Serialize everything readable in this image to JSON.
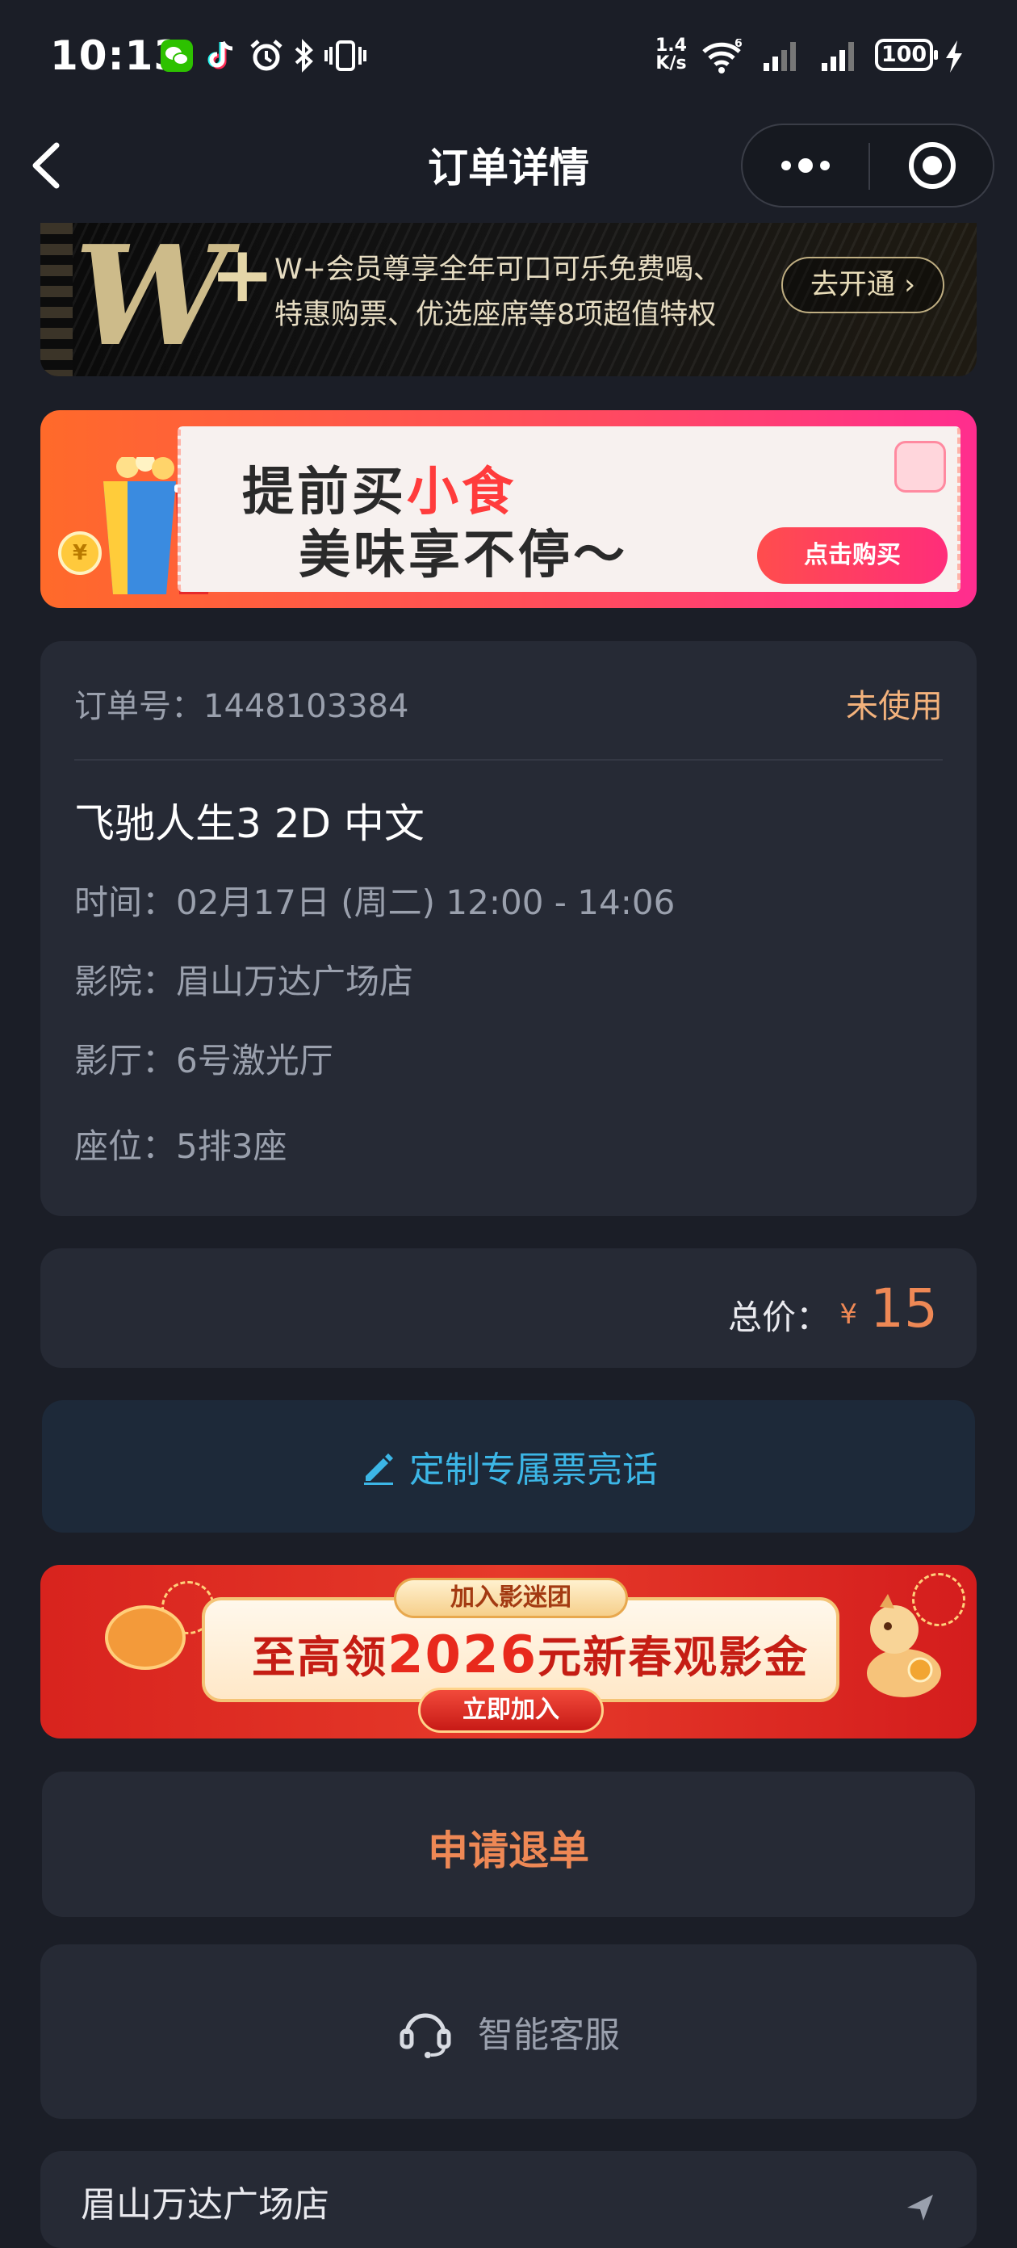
{
  "status_bar": {
    "time": "10:13",
    "net_speed_value": "1.4",
    "net_speed_unit": "K/s",
    "signal_label": "6",
    "battery": "100",
    "icons": [
      "wechat-icon",
      "tiktok-icon",
      "alarm-icon",
      "bluetooth-icon",
      "vibrate-icon",
      "wifi-icon",
      "signal-icon",
      "charging-icon"
    ]
  },
  "nav": {
    "title": "订单详情",
    "back_icon": "chevron-left-icon",
    "more_icon": "more-dots-icon",
    "close_icon": "target-close-icon"
  },
  "vip_banner": {
    "logo": "W",
    "plus": "+",
    "line1": "W+会员尊享全年可口可乐免费喝、",
    "line2": "特惠购票、优选座席等8项超值特权",
    "button": "去开通 ›"
  },
  "snack_banner": {
    "line1_prefix": "提前买",
    "line1_highlight": "小食",
    "line2": "美味享不停～",
    "button": "点击购买",
    "coin": "¥"
  },
  "order": {
    "order_no_label": "订单号：",
    "order_no": "1448103384",
    "status": "未使用",
    "movie_title": "飞驰人生3 2D 中文",
    "rows": [
      {
        "label": "时间：",
        "value": "02月17日 (周二) 12:00 - 14:06"
      },
      {
        "label": "影院：",
        "value": "眉山万达广场店"
      },
      {
        "label": "影厅：",
        "value": "6号激光厅"
      },
      {
        "label": "座位：",
        "value": "5排3座"
      }
    ]
  },
  "price": {
    "label": "总价：",
    "currency": "¥",
    "value": "15"
  },
  "custom": {
    "label": "定制专属票亮话",
    "icon": "pencil-icon"
  },
  "cny_banner": {
    "tag": "加入影迷团",
    "main_prefix": "至高领",
    "main_amount": "2026",
    "main_suffix": "元新春观影金",
    "button": "立即加入"
  },
  "refund": {
    "label": "申请退单"
  },
  "service": {
    "label": "智能客服",
    "icon": "headset-icon"
  },
  "cinema": {
    "name": "眉山万达广场店"
  },
  "colors": {
    "background": "#1b1e27",
    "card": "#262a35",
    "accent_orange": "#ee8855",
    "status_orange": "#f3b27c",
    "link_blue": "#3cb6e6"
  }
}
